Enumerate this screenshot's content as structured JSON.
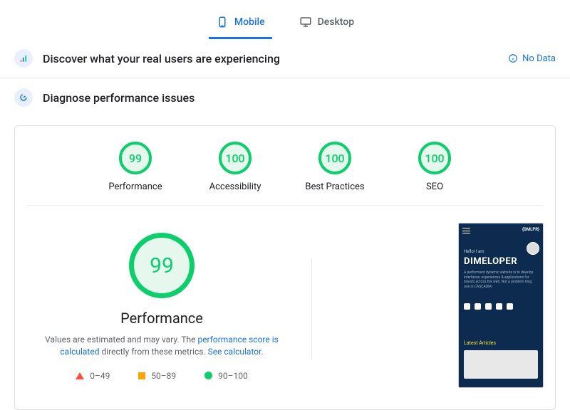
{
  "tabs": {
    "mobile": "Mobile",
    "desktop": "Desktop",
    "active": "mobile"
  },
  "section1": {
    "title": "Discover what your real users are experiencing",
    "status": "No Data"
  },
  "section2": {
    "title": "Diagnose performance issues"
  },
  "gauges": [
    {
      "label": "Performance",
      "score": 99
    },
    {
      "label": "Accessibility",
      "score": 100
    },
    {
      "label": "Best Practices",
      "score": 100
    },
    {
      "label": "SEO",
      "score": 100
    }
  ],
  "main_gauge": {
    "score": 99,
    "label": "Performance",
    "desc_pre": "Values are estimated and may vary. The ",
    "link1": "performance score is calculated",
    "desc_mid": " directly from these metrics. ",
    "link2": "See calculator",
    "desc_post": "."
  },
  "legend": {
    "low": "0–49",
    "mid": "50–89",
    "high": "90–100"
  },
  "screenshot": {
    "logo": "{DMLPR}",
    "hello": "Hello! I am",
    "name": "DIMELOPER",
    "lipsum": "A performant dynamic website is to develop interfaces, experiences & applications for brands across the web. Not a problem blog one in CASCADIA!",
    "latest": "Latest Articles"
  }
}
